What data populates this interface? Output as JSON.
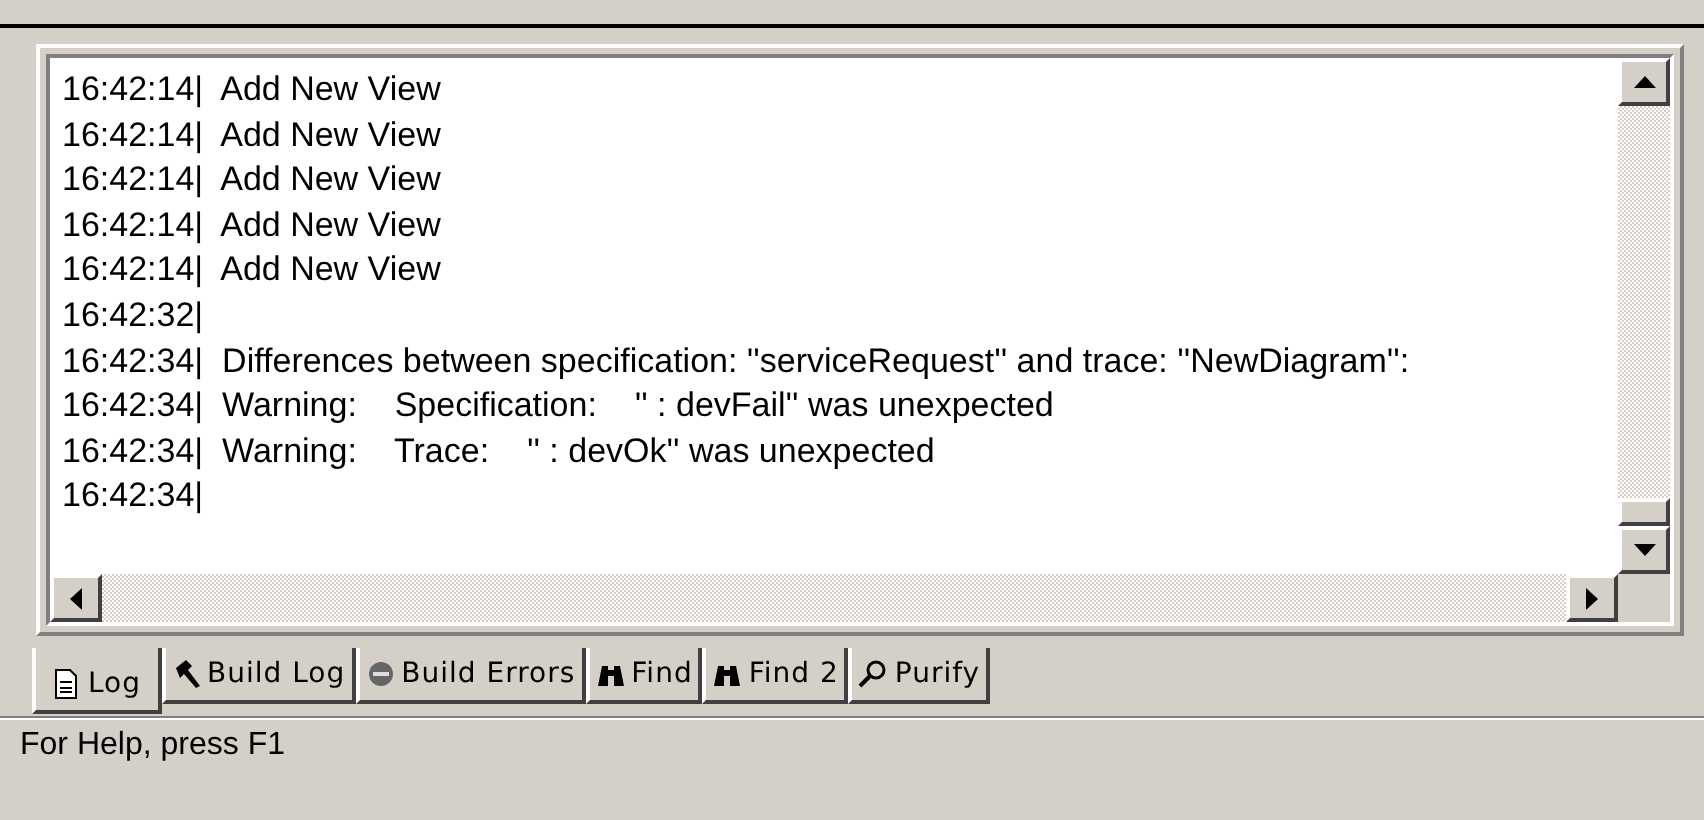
{
  "log": {
    "lines": [
      {
        "time": "16:42:14|",
        "message": "Add New View"
      },
      {
        "time": "16:42:14|",
        "message": "Add New View"
      },
      {
        "time": "16:42:14|",
        "message": "Add New View"
      },
      {
        "time": "16:42:14|",
        "message": "Add New View"
      },
      {
        "time": "16:42:14|",
        "message": "Add New View"
      },
      {
        "time": "16:42:32|"
      },
      {
        "time": "16:42:34|",
        "message": "Differences between specification: ''serviceRequest'' and trace: ''NewDiagram'':"
      },
      {
        "time": "16:42:34|",
        "message": "Warning:    Specification:    '' : devFail'' was unexpected"
      },
      {
        "time": "16:42:34|",
        "message": "Warning:    Trace:    '' : devOk'' was unexpected"
      },
      {
        "time": "16:42:34|"
      }
    ]
  },
  "tabs": [
    {
      "label": "Log",
      "kind": "document",
      "selected": true
    },
    {
      "label": "Build Log",
      "kind": "hammer",
      "selected": false
    },
    {
      "label": "Build Errors",
      "kind": "stop",
      "selected": false
    },
    {
      "label": "Find",
      "kind": "binoculars",
      "selected": false
    },
    {
      "label": "Find 2",
      "kind": "binoculars",
      "selected": false
    },
    {
      "label": "Purify",
      "kind": "magnifier",
      "selected": false
    }
  ],
  "status_bar": {
    "text": "For Help, press F1"
  }
}
